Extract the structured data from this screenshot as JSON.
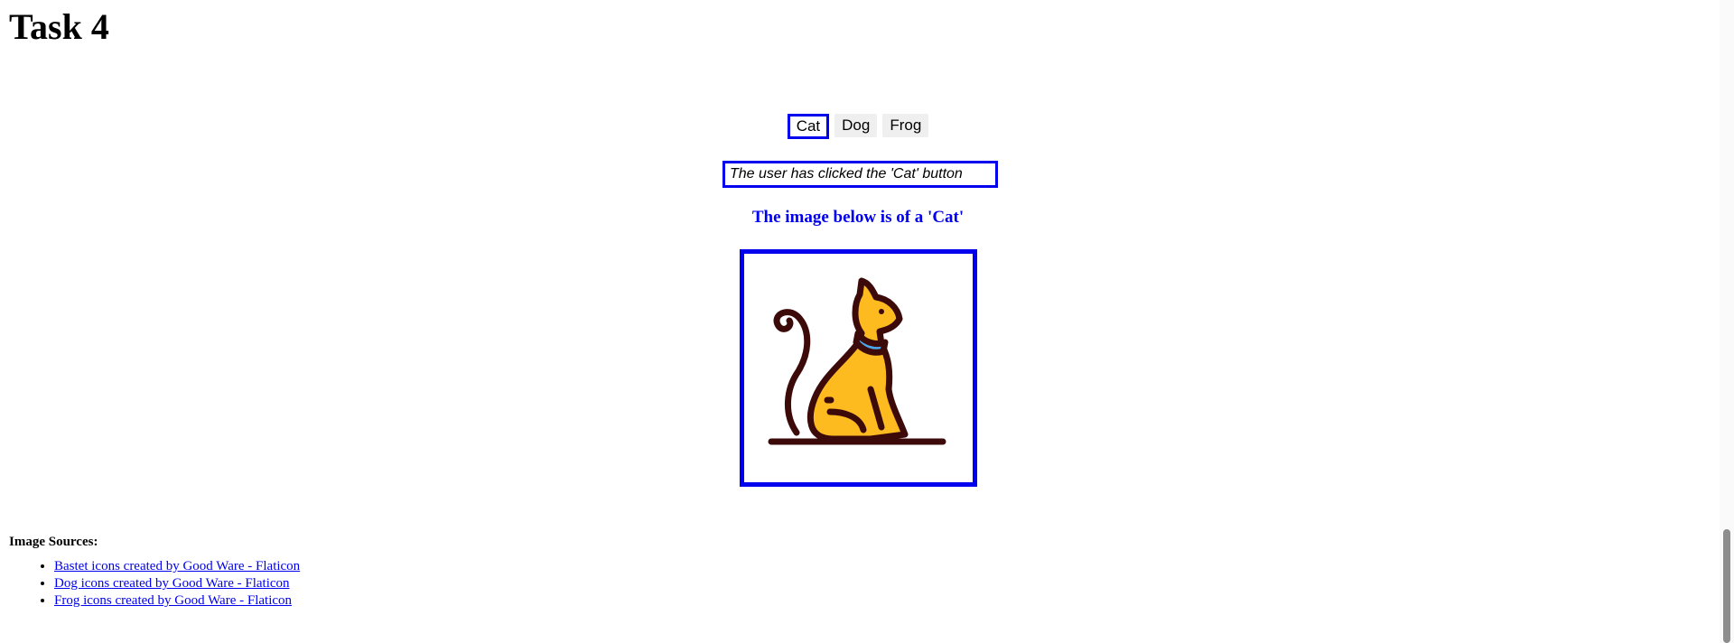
{
  "page": {
    "title": "Task 4"
  },
  "buttons": [
    {
      "label": "Cat",
      "selected": true
    },
    {
      "label": "Dog",
      "selected": false
    },
    {
      "label": "Frog",
      "selected": false
    }
  ],
  "status": {
    "text": "The user has clicked the 'Cat' button"
  },
  "image": {
    "caption": "The image below is of a 'Cat'",
    "icon": "cat-icon",
    "colors": {
      "frame": "#0000ee",
      "body": "#fdbb1f",
      "outline": "#3d0a0a",
      "collar": "#4da6e8"
    }
  },
  "sources": {
    "heading": "Image Sources:",
    "links": [
      "Bastet icons created by Good Ware - Flaticon",
      "Dog icons created by Good Ware - Flaticon",
      "Frog icons created by Good Ware - Flaticon"
    ]
  }
}
